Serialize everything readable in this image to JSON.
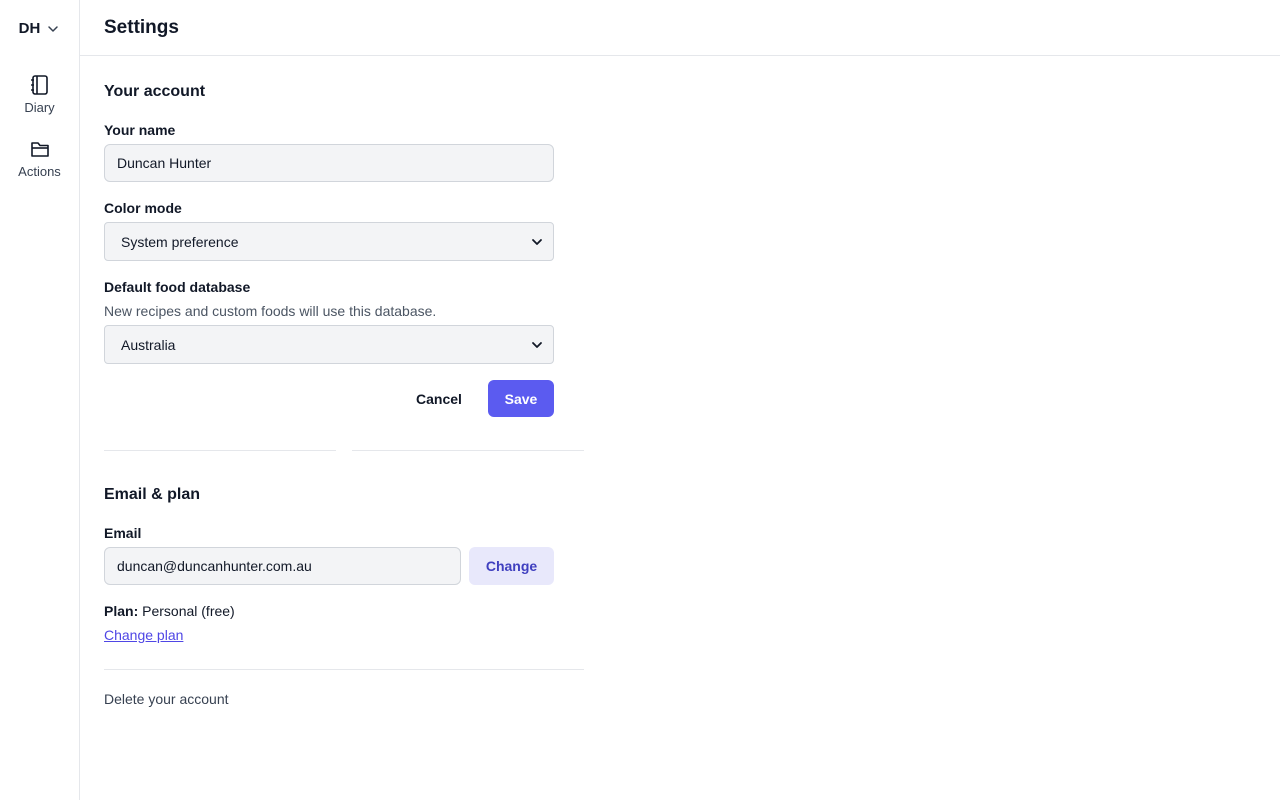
{
  "user_menu": {
    "initials": "DH",
    "icon": "chevron-down-icon"
  },
  "nav": [
    {
      "label": "Diary",
      "icon": "notebook-icon"
    },
    {
      "label": "Actions",
      "icon": "folder-icon"
    }
  ],
  "header": {
    "title": "Settings"
  },
  "account": {
    "section_title": "Your account",
    "name_label": "Your name",
    "name_value": "Duncan Hunter",
    "color_mode_label": "Color mode",
    "color_mode_value": "System preference",
    "food_db_label": "Default food database",
    "food_db_help": "New recipes and custom foods will use this database.",
    "food_db_value": "Australia",
    "cancel_label": "Cancel",
    "save_label": "Save"
  },
  "email_plan": {
    "section_title": "Email & plan",
    "email_label": "Email",
    "email_value": "duncan@duncanhunter.com.au",
    "change_label": "Change",
    "plan_label": "Plan:",
    "plan_value": "Personal (free)",
    "change_plan_label": "Change plan"
  },
  "delete_account_label": "Delete your account",
  "colors": {
    "accent": "#5b5bf0",
    "accent_soft": "#e8e8fb",
    "link": "#4f46e5",
    "border": "#e5e7eb"
  }
}
